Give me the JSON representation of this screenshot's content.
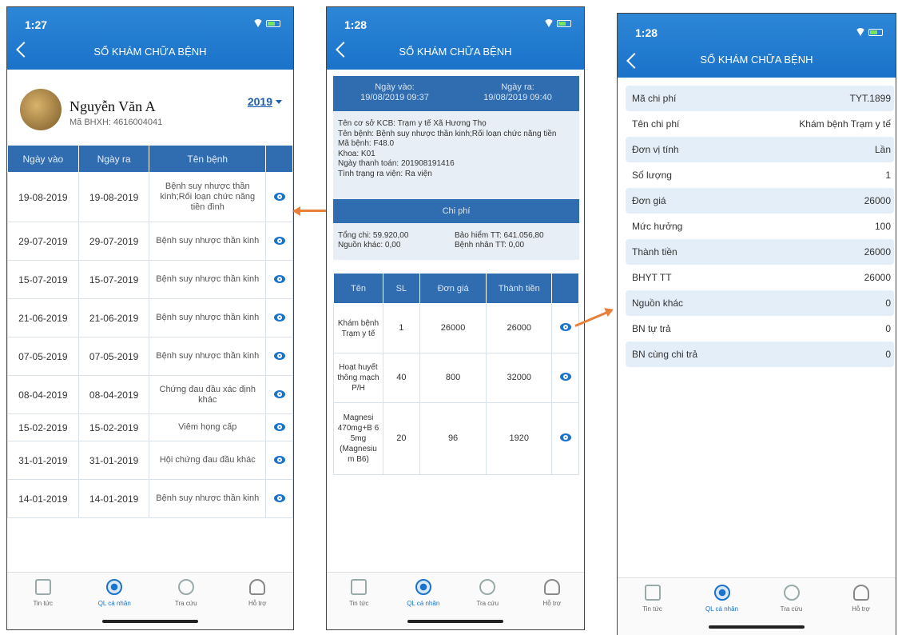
{
  "screen1": {
    "time": "1:27",
    "title": "SỔ KHÁM CHỮA BỆNH",
    "profile": {
      "name": "Nguyễn Văn A",
      "insurance_id": "Mã BHXH: 4616004041",
      "year": "2019"
    },
    "columns": [
      "Ngày vào",
      "Ngày ra",
      "Tên bệnh"
    ],
    "rows": [
      {
        "in": "19-08-2019",
        "out": "19-08-2019",
        "disease": "Bệnh suy nhược thần kinh;Rối loạn chức năng tiền đình"
      },
      {
        "in": "29-07-2019",
        "out": "29-07-2019",
        "disease": "Bệnh suy nhược thần kinh"
      },
      {
        "in": "15-07-2019",
        "out": "15-07-2019",
        "disease": "Bệnh suy nhược thần kinh"
      },
      {
        "in": "21-06-2019",
        "out": "21-06-2019",
        "disease": "Bệnh suy nhược thần kinh"
      },
      {
        "in": "07-05-2019",
        "out": "07-05-2019",
        "disease": "Bệnh suy nhược thần kinh"
      },
      {
        "in": "08-04-2019",
        "out": "08-04-2019",
        "disease": "Chứng đau đầu xác định khác"
      },
      {
        "in": "15-02-2019",
        "out": "15-02-2019",
        "disease": "Viêm họng cấp"
      },
      {
        "in": "31-01-2019",
        "out": "31-01-2019",
        "disease": "Hội chứng đau đầu khác"
      },
      {
        "in": "14-01-2019",
        "out": "14-01-2019",
        "disease": "Bệnh suy nhược thần kinh"
      }
    ]
  },
  "screen2": {
    "time": "1:28",
    "title": "SỔ KHÁM CHỮA BỆNH",
    "date_in_label": "Ngày vào:",
    "date_in": "19/08/2019 09:37",
    "date_out_label": "Ngày ra:",
    "date_out": "19/08/2019 09:40",
    "info": [
      "Tên cơ sở KCB:  Trạm y tế Xã Hương Thọ",
      "Tên bệnh:  Bệnh suy nhược thần kinh;Rối loạn chức năng tiền",
      "Mã bệnh: F48.0",
      "Khoa: K01",
      "Ngày thanh toán: 201908191416",
      "Tình trạng ra viện: Ra viện"
    ],
    "cost_header": "Chi phí",
    "total": "Tổng chi: 59.920,00",
    "insurance_paid": "Bảo hiểm TT: 641.056,80",
    "other_source": "Nguồn khác: 0,00",
    "patient_paid": "Bệnh nhân TT: 0,00",
    "columns": [
      "Tên",
      "SL",
      "Đơn giá",
      "Thành tiền"
    ],
    "rows": [
      {
        "name": "Khám bệnh Trạm y tế",
        "qty": "1",
        "price": "26000",
        "amount": "26000"
      },
      {
        "name": "Hoạt huyết thông mạch P/H",
        "qty": "40",
        "price": "800",
        "amount": "32000"
      },
      {
        "name": "Magnesi 470mg+B 6 5mg (Magnesiu m B6)",
        "qty": "20",
        "price": "96",
        "amount": "1920"
      }
    ]
  },
  "screen3": {
    "time": "1:28",
    "title": "SỔ KHÁM CHỮA BỆNH",
    "rows": [
      {
        "label": "Mã chi phí",
        "value": "TYT.1899"
      },
      {
        "label": "Tên chi phí",
        "value": "Khám bệnh Trạm y tế"
      },
      {
        "label": "Đơn vị tính",
        "value": "Lần"
      },
      {
        "label": "Số lượng",
        "value": "1"
      },
      {
        "label": "Đơn giá",
        "value": "26000"
      },
      {
        "label": "Mức hưởng",
        "value": "100"
      },
      {
        "label": "Thành tiền",
        "value": "26000"
      },
      {
        "label": "BHYT TT",
        "value": "26000"
      },
      {
        "label": "Nguồn khác",
        "value": "0"
      },
      {
        "label": "BN tự trả",
        "value": "0"
      },
      {
        "label": "BN cùng chi trả",
        "value": "0"
      }
    ]
  },
  "tabs": [
    {
      "label": "Tin tức",
      "icon": "news-icon"
    },
    {
      "label": "QL cá nhân",
      "icon": "user-circle-icon"
    },
    {
      "label": "Tra cứu",
      "icon": "search-icon"
    },
    {
      "label": "Hỗ trợ",
      "icon": "support-icon"
    }
  ],
  "colors": {
    "header": "#1a73c9",
    "table_header": "#2f6db0",
    "alt_row": "#e4eef8",
    "arrow": "#e8803a"
  }
}
